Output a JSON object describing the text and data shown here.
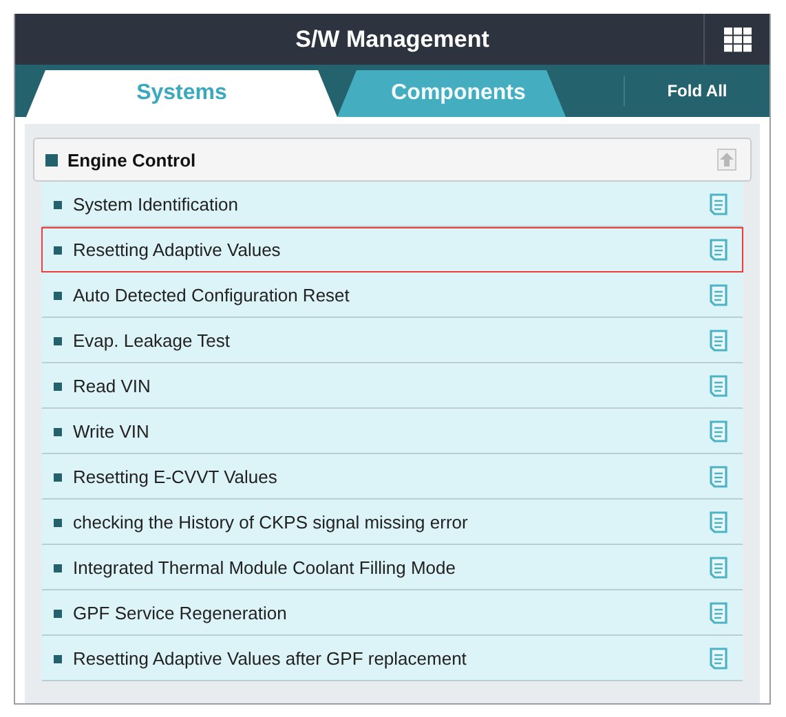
{
  "window": {
    "title": "S/W Management"
  },
  "tabs": [
    {
      "label": "Systems",
      "selected": true
    },
    {
      "label": "Components",
      "selected": false
    }
  ],
  "fold_all": "Fold All",
  "group": {
    "title": "Engine Control",
    "expanded": true,
    "items": [
      {
        "label": "System Identification",
        "selected": false
      },
      {
        "label": "Resetting Adaptive Values",
        "selected": true
      },
      {
        "label": "Auto Detected Configuration Reset",
        "selected": false
      },
      {
        "label": "Evap. Leakage Test",
        "selected": false
      },
      {
        "label": "Read VIN",
        "selected": false
      },
      {
        "label": "Write VIN",
        "selected": false
      },
      {
        "label": "Resetting E-CVVT Values",
        "selected": false
      },
      {
        "label": "checking the History of  CKPS signal missing error",
        "selected": false
      },
      {
        "label": "Integrated Thermal Module Coolant Filling Mode",
        "selected": false
      },
      {
        "label": "GPF Service Regeneration",
        "selected": false
      },
      {
        "label": "Resetting Adaptive Values after GPF replacement",
        "selected": false
      }
    ]
  }
}
